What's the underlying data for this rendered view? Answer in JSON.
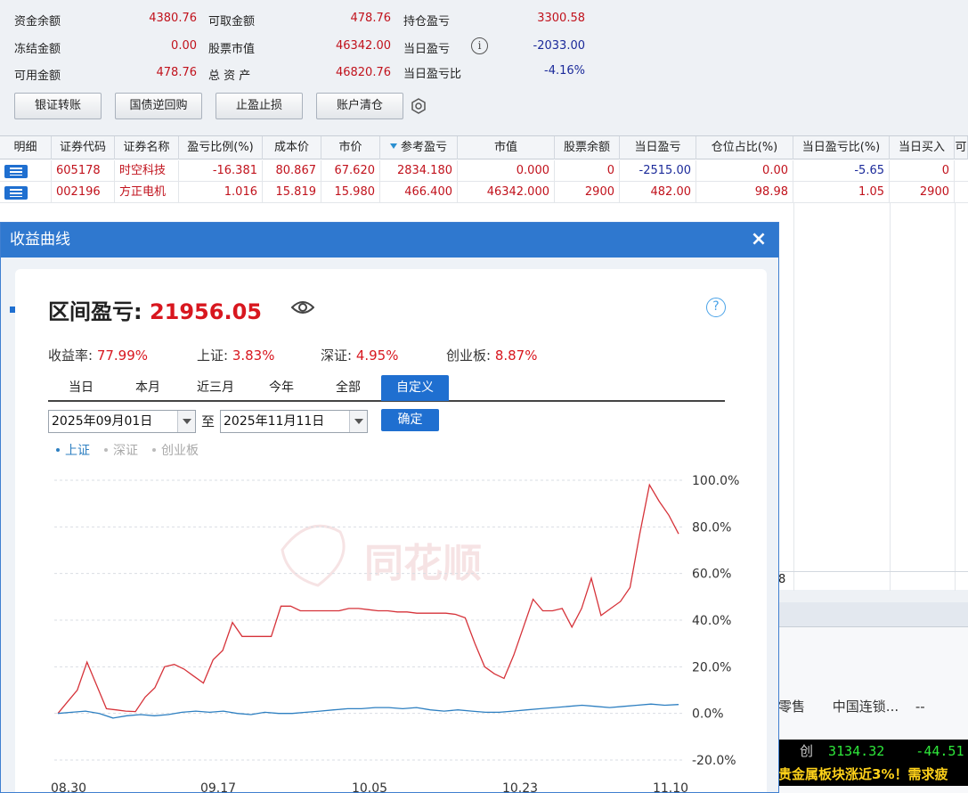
{
  "summary": {
    "items": [
      {
        "label": "资金余额",
        "value": "4380.76",
        "color": "red"
      },
      {
        "label": "冻结金额",
        "value": "0.00",
        "color": "red"
      },
      {
        "label": "可用金额",
        "value": "478.76",
        "color": "red"
      },
      {
        "label": "可取金额",
        "value": "478.76",
        "color": "red"
      },
      {
        "label": "股票市值",
        "value": "46342.00",
        "color": "red"
      },
      {
        "label": "总 资 产",
        "value": "46820.76",
        "color": "red"
      },
      {
        "label": "持仓盈亏",
        "value": "3300.58",
        "color": "red"
      },
      {
        "label": "当日盈亏",
        "value": "-2033.00",
        "color": "blue"
      },
      {
        "label": "当日盈亏比",
        "value": "-4.16%",
        "color": "blue"
      }
    ],
    "info_icon": "i"
  },
  "toolbar": {
    "buttons": [
      "银证转账",
      "国债逆回购",
      "止盈止损",
      "账户清仓"
    ]
  },
  "table": {
    "columns": [
      "明细",
      "证券代码",
      "证券名称",
      "盈亏比例(%)",
      "成本价",
      "市价",
      "参考盈亏",
      "市值",
      "股票余额",
      "当日盈亏",
      "仓位占比(%)",
      "当日盈亏比(%)",
      "当日买入",
      "可"
    ],
    "rows": [
      [
        "605178",
        "时空科技",
        "-16.381",
        "80.867",
        "67.620",
        "2834.180",
        "0.000",
        "0",
        "-2515.00",
        "0.00",
        "-5.65",
        "0"
      ],
      [
        "002196",
        "方正电机",
        "1.016",
        "15.819",
        "15.980",
        "466.400",
        "46342.000",
        "2900",
        "482.00",
        "98.98",
        "1.05",
        "2900"
      ]
    ]
  },
  "background": {
    "col_fragment": "8",
    "retail": "零售",
    "chain": "中国连锁...",
    "dash": "--",
    "quote_prefix": "创",
    "quote_value": "3134.32",
    "quote_change": "-44.51",
    "ticker": "贵金属板块涨近3%！需求疲"
  },
  "modal": {
    "title": "收益曲线",
    "close": "×",
    "range_label": "区间盈亏: ",
    "range_value": "21956.05",
    "help": "?",
    "stats": [
      {
        "label": "收益率: ",
        "value": "77.99%"
      },
      {
        "label": "上证: ",
        "value": "3.83%"
      },
      {
        "label": "深证: ",
        "value": "4.95%"
      },
      {
        "label": "创业板: ",
        "value": "8.87%"
      }
    ],
    "tabs": [
      "当日",
      "本月",
      "近三月",
      "今年",
      "全部",
      "自定义"
    ],
    "active_tab": "自定义",
    "start_date": "2025年09月01日",
    "to_label": "至",
    "end_date": "2025年11月11日",
    "confirm": "确定",
    "legend": [
      {
        "name": "上证",
        "active": true
      },
      {
        "name": "深证",
        "active": false
      },
      {
        "name": "创业板",
        "active": false
      }
    ],
    "watermark": "同花顺"
  },
  "colors": {
    "accent": "#1f6fd0",
    "profit_red": "#d8171f",
    "loss_blue": "#1b2a9a",
    "series_red": "#d6333a",
    "series_blue": "#2d7fc1"
  },
  "chart_data": {
    "type": "line",
    "x_ticks": [
      "08.30",
      "09.17",
      "10.05",
      "10.23",
      "11.10"
    ],
    "y_ticks": [
      "100.0%",
      "80.0%",
      "60.0%",
      "40.0%",
      "20.0%",
      "0.0%",
      "-20.0%"
    ],
    "ylim": [
      -20,
      100
    ],
    "grid": true,
    "series": [
      {
        "name": "收益",
        "color": "#d6333a",
        "values": [
          0,
          5,
          10,
          22,
          12,
          2,
          1.5,
          1,
          0.8,
          7,
          11,
          20,
          21,
          19,
          16,
          13,
          23,
          27,
          39,
          33,
          33,
          33,
          33,
          46,
          46,
          44,
          44,
          44,
          44,
          44,
          45,
          45,
          44.5,
          44,
          44,
          43.5,
          43.5,
          43,
          43,
          43,
          43,
          42.5,
          41,
          30,
          20,
          17,
          15,
          25,
          37,
          49,
          44,
          44,
          45,
          37,
          45,
          58,
          42,
          45,
          48,
          54,
          77,
          98,
          91,
          85,
          77
        ]
      },
      {
        "name": "上证",
        "color": "#2d7fc1",
        "values": [
          0,
          0.5,
          1,
          0,
          -2,
          -1,
          -0.5,
          -1,
          -0.5,
          0.5,
          1,
          0.5,
          1,
          0,
          -0.5,
          0.5,
          0,
          0,
          0.5,
          1,
          1.5,
          2,
          2,
          2.5,
          2.5,
          2,
          2.5,
          1.5,
          1,
          1.5,
          1,
          0.5,
          0.5,
          1,
          1.5,
          2,
          2.5,
          3,
          3.5,
          3,
          2.5,
          3,
          3.5,
          4,
          3.5,
          3.8
        ]
      }
    ]
  }
}
